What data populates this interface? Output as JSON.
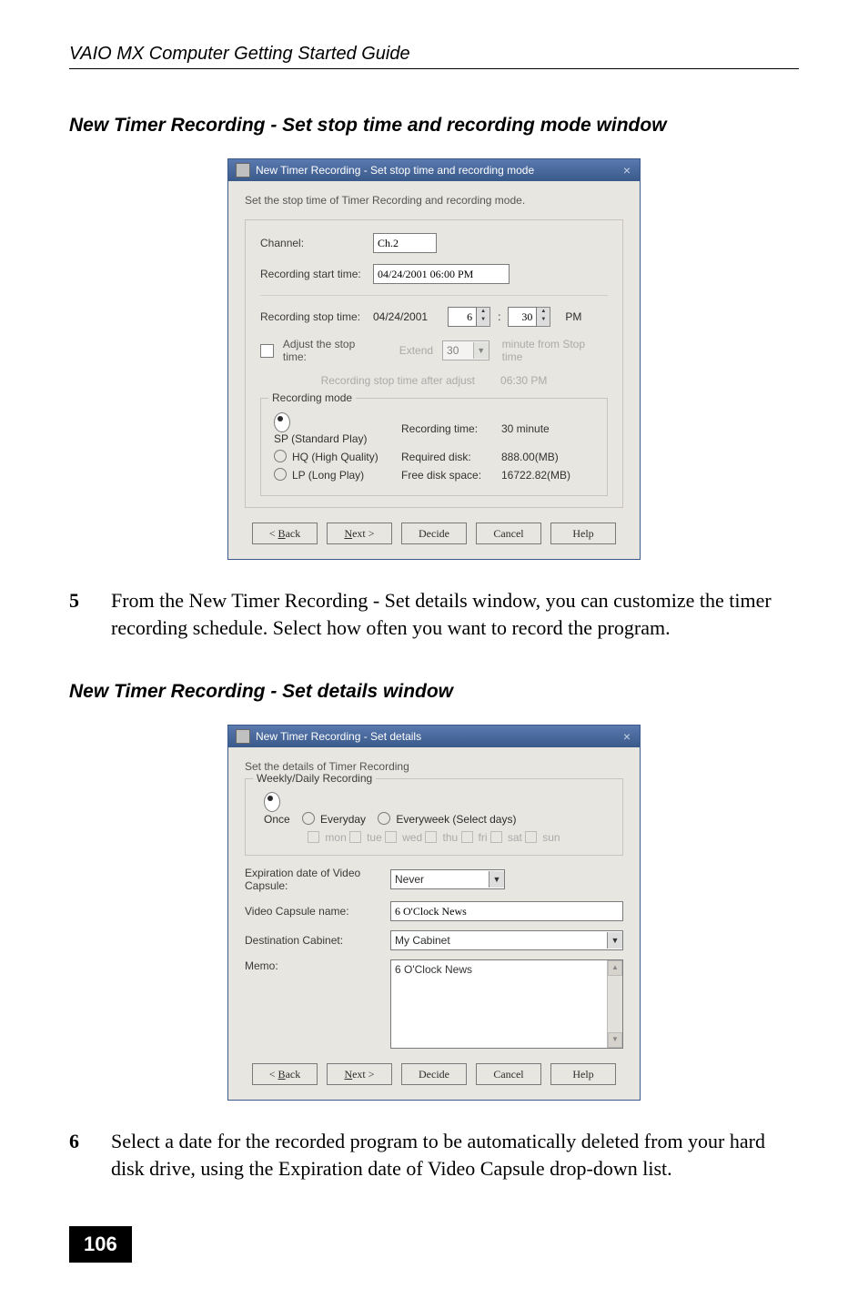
{
  "header": {
    "guide_title": "VAIO MX Computer Getting Started Guide"
  },
  "sec1": {
    "title": "New Timer Recording - Set stop time and recording mode window",
    "dlg_title": "New Timer Recording - Set stop time and recording mode",
    "intro": "Set the stop time of Timer Recording and recording mode.",
    "channel_lbl": "Channel:",
    "channel_val": "Ch.2",
    "start_lbl": "Recording start time:",
    "start_val": "04/24/2001 06:00 PM",
    "stop_lbl": "Recording stop time:",
    "stop_date": "04/24/2001",
    "stop_hh": "6",
    "stop_mm": "30",
    "stop_ampm": "PM",
    "adjust_lbl": "Adjust the stop time:",
    "extend_lbl": "Extend",
    "extend_val": "30",
    "extend_after": "minute from Stop time",
    "after_lbl": "Recording stop time after adjust",
    "after_val": "06:30 PM",
    "group_lbl": "Recording mode",
    "opt_sp": "SP (Standard Play)",
    "opt_hq": "HQ (High Quality)",
    "opt_lp": "LP (Long Play)",
    "lbl_rt": "Recording time:",
    "val_rt": "30 minute",
    "lbl_rd": "Required disk:",
    "val_rd": "888.00(MB)",
    "lbl_fd": "Free disk space:",
    "val_fd": "16722.82(MB)"
  },
  "step5": {
    "num": "5",
    "text": "From the New Timer Recording - Set details window, you can customize the timer recording schedule. Select how often you want to record the program."
  },
  "sec2": {
    "title": "New Timer Recording - Set details window",
    "dlg_title": "New Timer Recording - Set details",
    "intro": "Set the details of Timer Recording",
    "group_lbl": "Weekly/Daily Recording",
    "opt_once": "Once",
    "opt_everyday": "Everyday",
    "opt_everyweek": "Everyweek (Select days)",
    "d_mon": "mon",
    "d_tue": "tue",
    "d_wed": "wed",
    "d_thu": "thu",
    "d_fri": "fri",
    "d_sat": "sat",
    "d_sun": "sun",
    "exp_lbl": "Expiration date of Video Capsule:",
    "exp_val": "Never",
    "vcn_lbl": "Video Capsule name:",
    "vcn_val": "6 O'Clock News",
    "dc_lbl": "Destination Cabinet:",
    "dc_val": "My Cabinet",
    "memo_lbl": "Memo:",
    "memo_val": "6 O'Clock News"
  },
  "step6": {
    "num": "6",
    "text": "Select a date for the recorded program to be automatically deleted from your hard disk drive, using the Expiration date of Video Capsule drop-down list."
  },
  "buttons": {
    "back_pre": "< ",
    "back_u": "B",
    "back_post": "ack",
    "next_u": "N",
    "next_post": "ext >",
    "decide": "Decide",
    "cancel": "Cancel",
    "help": "Help"
  },
  "page_num": "106"
}
